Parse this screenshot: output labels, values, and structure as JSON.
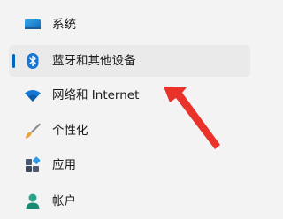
{
  "nav": {
    "items": [
      {
        "label": "系统",
        "icon": "display-icon",
        "selected": false
      },
      {
        "label": "蓝牙和其他设备",
        "icon": "bluetooth-icon",
        "selected": true
      },
      {
        "label": "网络和 Internet",
        "icon": "wifi-icon",
        "selected": false
      },
      {
        "label": "个性化",
        "icon": "brush-icon",
        "selected": false
      },
      {
        "label": "应用",
        "icon": "apps-icon",
        "selected": false
      },
      {
        "label": "帐户",
        "icon": "person-icon",
        "selected": false
      }
    ]
  },
  "colors": {
    "accent": "#0067c0",
    "annotation_arrow": "#e8322a",
    "background": "#f3f3f3",
    "selected_background": "#eaeaea"
  }
}
